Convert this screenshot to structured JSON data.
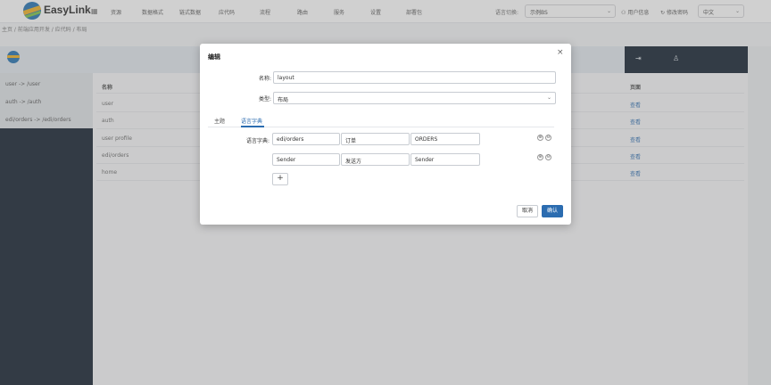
{
  "topnav": {
    "brand": "EasyLink",
    "grid_icon": "grid-icon",
    "items": [
      "资源",
      "数据格式",
      "链式数据",
      "应代码",
      "流程",
      "路由",
      "服务",
      "设置",
      "部署包"
    ],
    "lang_label": "语言切换:",
    "project_select": "示例BS",
    "account": "用户信息",
    "password": "修改密码",
    "language_select": "中文"
  },
  "breadcrumb": "主页 / 前端应用开发 / 应代码 / 布局",
  "band": {
    "logout_icon": "logout-icon",
    "user_icon": "user-icon"
  },
  "sidebar": {
    "items": [
      "user -> /user",
      "auth -> /auth",
      "edi/orders -> /edi/orders"
    ]
  },
  "table": {
    "col_name": "名称",
    "col_action": "页面",
    "rows": [
      {
        "name": "user",
        "action": "查看"
      },
      {
        "name": "auth",
        "action": "查看"
      },
      {
        "name": "user profile",
        "action": "查看"
      },
      {
        "name": "edi/orders",
        "action": "查看"
      },
      {
        "name": "home",
        "action": "查看"
      }
    ]
  },
  "modal": {
    "title": "编辑",
    "name_label": "名称:",
    "name_value": "layout",
    "type_label": "类型:",
    "type_value": "布局",
    "tabs": [
      "主题",
      "语言字典"
    ],
    "dict_label": "语言字典:",
    "dict_rows": [
      {
        "key": "edi/orders",
        "zh": "订单",
        "en": "ORDERS"
      },
      {
        "key": "Sender",
        "zh": "发送方",
        "en": "Sender"
      }
    ],
    "add_symbol": "+",
    "row_add_symbol": "⊕",
    "row_remove_symbol": "⊖",
    "cancel": "取消",
    "ok": "确认",
    "close_symbol": "×"
  },
  "colors": {
    "accent": "#2b6cb0",
    "sidebar_dark": "#0e1b2a"
  }
}
